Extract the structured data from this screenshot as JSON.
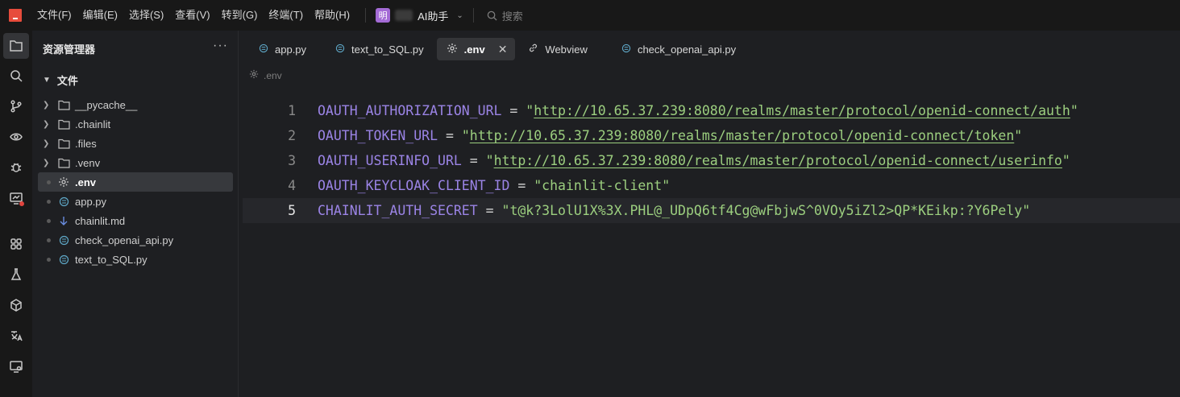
{
  "menu": [
    "文件(F)",
    "编辑(E)",
    "选择(S)",
    "查看(V)",
    "转到(G)",
    "终端(T)",
    "帮助(H)"
  ],
  "assistant": {
    "avatar_char": "明",
    "label": "AI助手"
  },
  "search": {
    "placeholder": "搜索"
  },
  "explorer": {
    "title": "资源管理器",
    "more": "···",
    "root": "文件",
    "items": [
      {
        "name": "__pycache__",
        "type": "folder"
      },
      {
        "name": ".chainlit",
        "type": "folder"
      },
      {
        "name": ".files",
        "type": "folder"
      },
      {
        "name": ".venv",
        "type": "folder"
      },
      {
        "name": ".env",
        "type": "settings-file",
        "selected": true
      },
      {
        "name": "app.py",
        "type": "python-file"
      },
      {
        "name": "chainlit.md",
        "type": "markdown-file"
      },
      {
        "name": "check_openai_api.py",
        "type": "python-file"
      },
      {
        "name": "text_to_SQL.py",
        "type": "python-file"
      }
    ]
  },
  "tabs": [
    {
      "label": "app.py",
      "icon": "python-icon"
    },
    {
      "label": "text_to_SQL.py",
      "icon": "python-icon"
    },
    {
      "label": ".env",
      "icon": "gear-icon",
      "active": true,
      "close": "✕"
    },
    {
      "label": "Webview",
      "icon": "link-icon"
    },
    {
      "label": "check_openai_api.py",
      "icon": "python-icon"
    }
  ],
  "breadcrumb": ".env",
  "code_lines": [
    {
      "num": "1",
      "key": "OAUTH_AUTHORIZATION_URL",
      "op": " = ",
      "q1": "\"",
      "value": "http://10.65.37.239:8080/realms/master/protocol/openid-connect/auth",
      "q2": "\""
    },
    {
      "num": "2",
      "key": "OAUTH_TOKEN_URL",
      "op": " = ",
      "q1": "\"",
      "value": "http://10.65.37.239:8080/realms/master/protocol/openid-connect/token",
      "q2": "\""
    },
    {
      "num": "3",
      "key": "OAUTH_USERINFO_URL",
      "op": " = ",
      "q1": "\"",
      "value": "http://10.65.37.239:8080/realms/master/protocol/openid-connect/userinfo",
      "q2": "\""
    },
    {
      "num": "4",
      "key": "OAUTH_KEYCLOAK_CLIENT_ID",
      "op": " = ",
      "q1": "\"",
      "value": "chainlit-client",
      "q2": "\""
    },
    {
      "num": "5",
      "key": "CHAINLIT_AUTH_SECRET",
      "op": " = ",
      "q1": "\"",
      "value": "t@k?3LolU1X%3X.PHL@_UDpQ6tf4Cg@wFbjwS^0VOy5iZl2>QP*KEikp:?Y6Pely",
      "q2": "\""
    }
  ],
  "colors": {
    "accent": "#9b84e6",
    "string": "#9ccf7f",
    "logo": "#e74c3c",
    "notification": "#e0443e"
  }
}
